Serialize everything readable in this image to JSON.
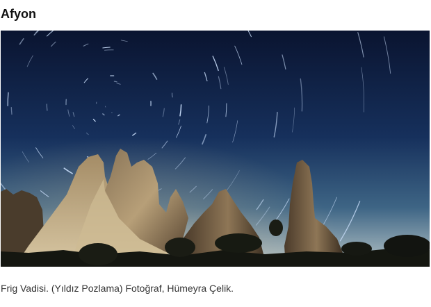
{
  "article": {
    "title": "Afyon",
    "caption": "Frig Vadisi. (Yıldız Pozlama) Fotoğraf, Hümeyra Çelik."
  },
  "photo": {
    "subject": "star-trails-over-rock-formations",
    "colors": {
      "sky_top": "#0a1430",
      "sky_mid": "#1d3a6e",
      "sky_horizon": "#8fa7b8",
      "rock_light": "#a88f6a",
      "rock_dark": "#3a2e22",
      "ground": "#141610",
      "trail": "#cfe3ff"
    }
  }
}
